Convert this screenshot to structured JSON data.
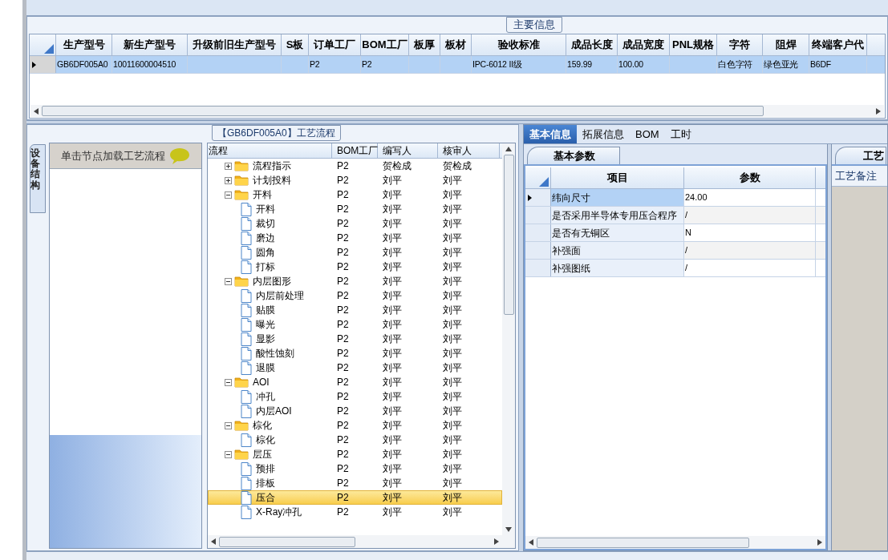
{
  "main_info": {
    "title": "主要信息",
    "columns": [
      "生产型号",
      "新生产型号",
      "升级前旧生产型号",
      "S板",
      "订单工厂",
      "BOM工厂",
      "板厚",
      "板材",
      "验收标准",
      "成品长度",
      "成品宽度",
      "PNL规格",
      "字符",
      "阻焊",
      "终端客户代"
    ],
    "rows": [
      {
        "selected": true,
        "cells": [
          "GB6DF005A0",
          "10011600004510",
          "",
          "",
          "P2",
          "P2",
          "",
          "",
          "IPC-6012 II级",
          "159.99",
          "100.00",
          "",
          "白色字符",
          "绿色亚光",
          "B6DF"
        ]
      }
    ]
  },
  "flow": {
    "title": "【GB6DF005A0】工艺流程",
    "side_tab": "设备结构",
    "hint": "单击节点加载工艺流程",
    "columns": [
      "流程",
      "BOM工厂",
      "编写人",
      "核审人"
    ],
    "tree": [
      {
        "name": "流程指示",
        "cells": [
          "P2",
          "贺检成",
          "贺检成"
        ],
        "expanded": false,
        "selected": false
      },
      {
        "name": "计划投料",
        "cells": [
          "P2",
          "刘平",
          "刘平"
        ],
        "expanded": false,
        "selected": false
      },
      {
        "name": "开料",
        "cells": [
          "P2",
          "刘平",
          "刘平"
        ],
        "expanded": true,
        "selected": false,
        "children": [
          {
            "name": "开料",
            "cells": [
              "P2",
              "刘平",
              "刘平"
            ],
            "selected": false
          },
          {
            "name": "裁切",
            "cells": [
              "P2",
              "刘平",
              "刘平"
            ],
            "selected": false
          },
          {
            "name": "磨边",
            "cells": [
              "P2",
              "刘平",
              "刘平"
            ],
            "selected": false
          },
          {
            "name": "圆角",
            "cells": [
              "P2",
              "刘平",
              "刘平"
            ],
            "selected": false
          },
          {
            "name": "打标",
            "cells": [
              "P2",
              "刘平",
              "刘平"
            ],
            "selected": false
          }
        ]
      },
      {
        "name": "内层图形",
        "cells": [
          "P2",
          "刘平",
          "刘平"
        ],
        "expanded": true,
        "selected": false,
        "children": [
          {
            "name": "内层前处理",
            "cells": [
              "P2",
              "刘平",
              "刘平"
            ],
            "selected": false
          },
          {
            "name": "贴膜",
            "cells": [
              "P2",
              "刘平",
              "刘平"
            ],
            "selected": false
          },
          {
            "name": "曝光",
            "cells": [
              "P2",
              "刘平",
              "刘平"
            ],
            "selected": false
          },
          {
            "name": "显影",
            "cells": [
              "P2",
              "刘平",
              "刘平"
            ],
            "selected": false
          },
          {
            "name": "酸性蚀刻",
            "cells": [
              "P2",
              "刘平",
              "刘平"
            ],
            "selected": false
          },
          {
            "name": "退膜",
            "cells": [
              "P2",
              "刘平",
              "刘平"
            ],
            "selected": false
          }
        ]
      },
      {
        "name": "AOI",
        "cells": [
          "P2",
          "刘平",
          "刘平"
        ],
        "expanded": true,
        "selected": false,
        "children": [
          {
            "name": "冲孔",
            "cells": [
              "P2",
              "刘平",
              "刘平"
            ],
            "selected": false
          },
          {
            "name": "内层AOI",
            "cells": [
              "P2",
              "刘平",
              "刘平"
            ],
            "selected": false
          }
        ]
      },
      {
        "name": "棕化",
        "cells": [
          "P2",
          "刘平",
          "刘平"
        ],
        "expanded": true,
        "selected": false,
        "children": [
          {
            "name": "棕化",
            "cells": [
              "P2",
              "刘平",
              "刘平"
            ],
            "selected": false
          }
        ]
      },
      {
        "name": "层压",
        "cells": [
          "P2",
          "刘平",
          "刘平"
        ],
        "expanded": true,
        "selected": false,
        "children": [
          {
            "name": "预排",
            "cells": [
              "P2",
              "刘平",
              "刘平"
            ],
            "selected": false
          },
          {
            "name": "排板",
            "cells": [
              "P2",
              "刘平",
              "刘平"
            ],
            "selected": false
          },
          {
            "name": "压合",
            "cells": [
              "P2",
              "刘平",
              "刘平"
            ],
            "selected": true
          },
          {
            "name": "X-Ray冲孔",
            "cells": [
              "P2",
              "刘平",
              "刘平"
            ],
            "selected": false
          }
        ]
      }
    ]
  },
  "detail": {
    "tabs": [
      {
        "label": "基本信息",
        "selected": true
      },
      {
        "label": "拓展信息",
        "selected": false
      },
      {
        "label": "BOM",
        "selected": false
      },
      {
        "label": "工时",
        "selected": false
      }
    ],
    "panel_title": "基本参数",
    "columns": [
      "项目",
      "参数"
    ],
    "rows": [
      {
        "item": "纬向尺寸",
        "value": "24.00",
        "selected": true
      },
      {
        "item": "是否采用半导体专用压合程序",
        "value": "/",
        "selected": false
      },
      {
        "item": "是否有无铜区",
        "value": "N",
        "selected": false
      },
      {
        "item": "补强面",
        "value": "/",
        "selected": false
      },
      {
        "item": "补强图纸",
        "value": "/",
        "selected": false
      }
    ]
  },
  "notes": {
    "title": "工艺",
    "label": "工艺备注"
  }
}
